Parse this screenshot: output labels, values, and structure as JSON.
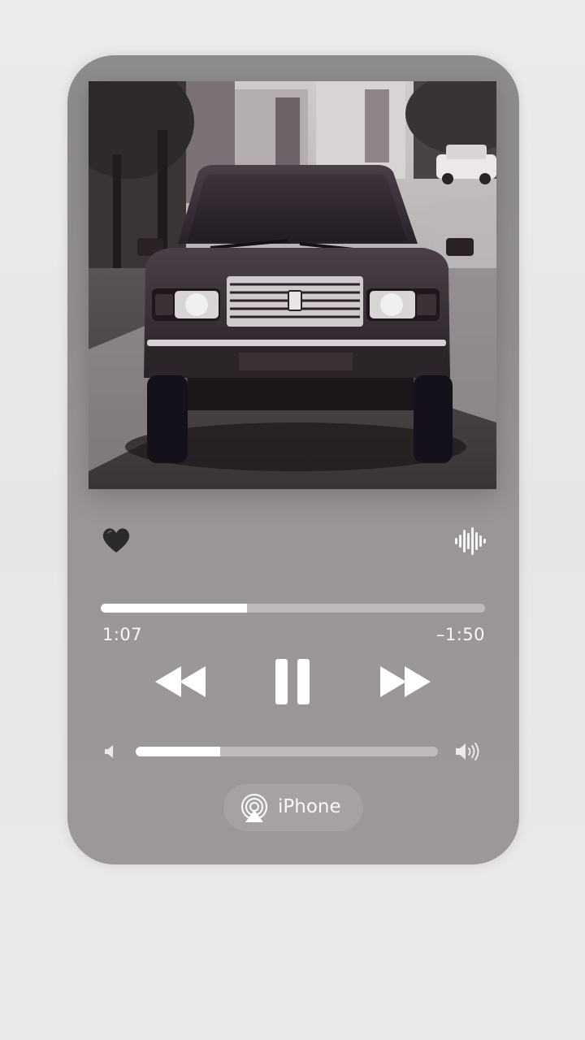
{
  "player": {
    "elapsed": "1:07",
    "remaining": "–1:50",
    "progress_fraction": 0.38,
    "volume_fraction": 0.28,
    "output_device": "iPhone",
    "favorited": true,
    "playback_state": "playing",
    "artwork": "black-and-white photo of a vintage sedan car on a street"
  },
  "icons": {
    "heart": "heart-icon",
    "waveform": "waveform-icon",
    "rewind": "rewind-icon",
    "pause": "pause-icon",
    "forward": "fast-forward-icon",
    "volume_low": "speaker-low-icon",
    "volume_high": "speaker-high-icon",
    "airplay": "airplay-icon"
  },
  "colors": {
    "panel": "#938f90",
    "accent": "#ffffff",
    "heart": "#2b2a2b"
  }
}
